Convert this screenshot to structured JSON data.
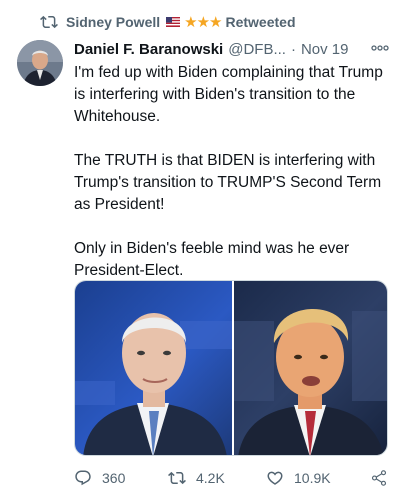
{
  "social_context": {
    "name": "Sidney Powell",
    "suffix": "Retweeted",
    "stars": "★★★",
    "stars_color": "#f5a623"
  },
  "tweet": {
    "author_name": "Daniel F. Baranowski",
    "handle": "@DFB...",
    "separator": "·",
    "date": "Nov 19",
    "paragraphs": [
      "I'm fed up with Biden complaining that Trump is interfering with Biden's transition to the Whitehouse.",
      "The TRUTH is that BIDEN is interfering with Trump's transition to TRUMP'S Second Term as President!",
      "Only in Biden's feeble mind was he ever President-Elect."
    ]
  },
  "actions": {
    "replies": "360",
    "retweets": "4.2K",
    "likes": "10.9K"
  },
  "icons": {
    "retweet_context": "retweet-icon",
    "flag": "us-flag-icon",
    "more": "more-icon",
    "reply": "reply-icon",
    "retweet": "retweet-icon",
    "like": "heart-icon",
    "share": "share-icon"
  },
  "colors": {
    "text": "#0f1419",
    "secondary": "#536471",
    "border": "#cfd9de"
  }
}
